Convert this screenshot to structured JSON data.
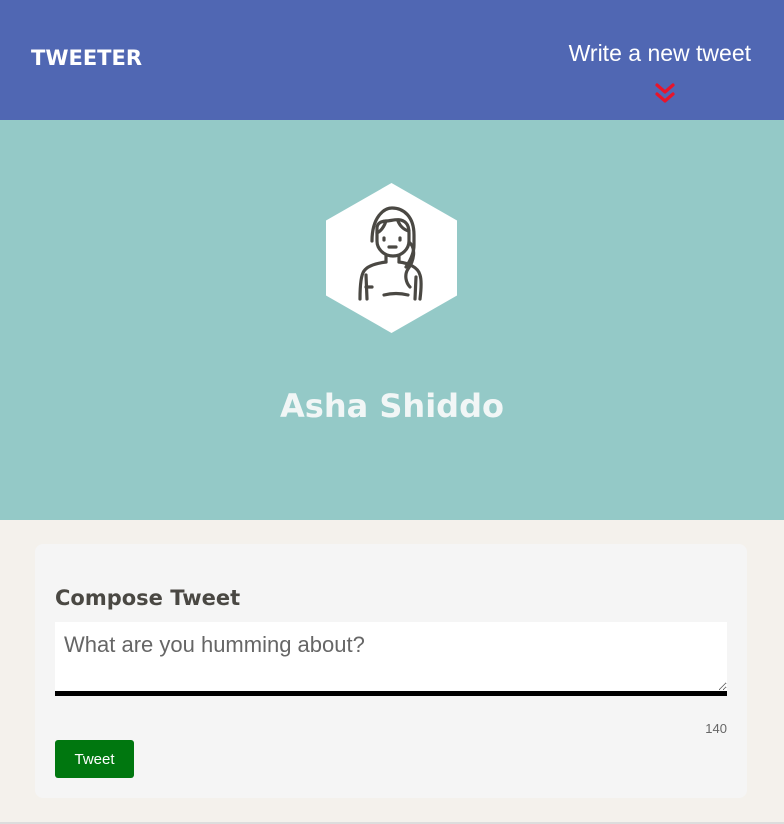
{
  "nav": {
    "logo": "TWEETER",
    "write_link": "Write a new tweet",
    "chevron_icon": "double-chevron-down-icon",
    "chevron_color": "#e8142b"
  },
  "profile": {
    "avatar_icon": "female-avatar-icon",
    "name": "Asha Shiddo"
  },
  "compose": {
    "title": "Compose Tweet",
    "placeholder": "What are you humming about?",
    "value": "",
    "counter": "140",
    "button_label": "Tweet"
  },
  "colors": {
    "nav_bg": "#5067b3",
    "header_bg": "#94c9c7",
    "page_bg": "#f4f1ec",
    "button_bg": "#00770f"
  }
}
